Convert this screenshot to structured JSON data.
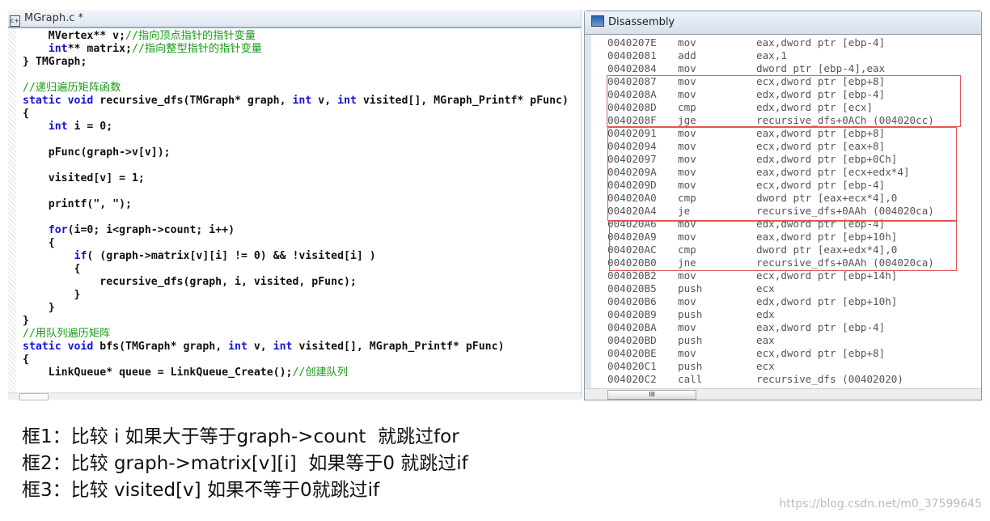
{
  "editor": {
    "title": "MGraph.c *",
    "lines": [
      [
        {
          "t": "    MVertex** v;"
        },
        {
          "t": "//指向顶点指针的指针变量",
          "c": "cm"
        }
      ],
      [
        {
          "t": "    "
        },
        {
          "t": "int",
          "c": "kw"
        },
        {
          "t": "** matrix;"
        },
        {
          "t": "//指向整型指针的指针变量",
          "c": "cm"
        }
      ],
      [
        {
          "t": "} TMGraph;"
        }
      ],
      [],
      [
        {
          "t": "//递归遍历矩阵函数",
          "c": "cm"
        }
      ],
      [
        {
          "t": "static void",
          "c": "kw"
        },
        {
          "t": " recursive_dfs(TMGraph* graph, "
        },
        {
          "t": "int",
          "c": "kw"
        },
        {
          "t": " v, "
        },
        {
          "t": "int",
          "c": "kw"
        },
        {
          "t": " visited[], MGraph_Printf* pFunc)"
        }
      ],
      [
        {
          "t": "{"
        }
      ],
      [
        {
          "t": "    "
        },
        {
          "t": "int",
          "c": "kw"
        },
        {
          "t": " i = 0;"
        }
      ],
      [],
      [
        {
          "t": "    pFunc(graph->v[v]);"
        }
      ],
      [],
      [
        {
          "t": "    visited[v] = 1;"
        }
      ],
      [],
      [
        {
          "t": "    printf(\", \");"
        }
      ],
      [],
      [
        {
          "t": "    "
        },
        {
          "t": "for",
          "c": "kw"
        },
        {
          "t": "(i=0; i<graph->count; i++)"
        }
      ],
      [
        {
          "t": "    {"
        }
      ],
      [
        {
          "t": "        "
        },
        {
          "t": "if",
          "c": "kw"
        },
        {
          "t": "( (graph->matrix[v][i] != 0) && !visited[i] )"
        }
      ],
      [
        {
          "t": "        {"
        }
      ],
      [
        {
          "t": "            recursive_dfs(graph, i, visited, pFunc);"
        }
      ],
      [
        {
          "t": "        }"
        }
      ],
      [
        {
          "t": "    }"
        }
      ],
      [
        {
          "t": "}"
        }
      ],
      [
        {
          "t": "//用队列遍历矩阵",
          "c": "cm"
        }
      ],
      [
        {
          "t": "static void",
          "c": "kw"
        },
        {
          "t": " bfs(TMGraph* graph, "
        },
        {
          "t": "int",
          "c": "kw"
        },
        {
          "t": " v, "
        },
        {
          "t": "int",
          "c": "kw"
        },
        {
          "t": " visited[], MGraph_Printf* pFunc)"
        }
      ],
      [
        {
          "t": "{"
        }
      ],
      [
        {
          "t": "    LinkQueue* queue = LinkQueue_Create();"
        },
        {
          "t": "//创建队列",
          "c": "cm"
        }
      ]
    ]
  },
  "disassembly": {
    "title": "Disassembly",
    "scroll_thumb": "III",
    "rows": [
      [
        "0040207E",
        "mov",
        "eax,dword ptr [ebp-4]"
      ],
      [
        "00402081",
        "add",
        "eax,1"
      ],
      [
        "00402084",
        "mov",
        "dword ptr [ebp-4],eax"
      ],
      [
        "00402087",
        "mov",
        "ecx,dword ptr [ebp+8]"
      ],
      [
        "0040208A",
        "mov",
        "edx,dword ptr [ebp-4]"
      ],
      [
        "0040208D",
        "cmp",
        "edx,dword ptr [ecx]"
      ],
      [
        "0040208F",
        "jge",
        "recursive_dfs+0ACh (004020cc)"
      ],
      [
        "00402091",
        "mov",
        "eax,dword ptr [ebp+8]"
      ],
      [
        "00402094",
        "mov",
        "ecx,dword ptr [eax+8]"
      ],
      [
        "00402097",
        "mov",
        "edx,dword ptr [ebp+0Ch]"
      ],
      [
        "0040209A",
        "mov",
        "eax,dword ptr [ecx+edx*4]"
      ],
      [
        "0040209D",
        "mov",
        "ecx,dword ptr [ebp-4]"
      ],
      [
        "004020A0",
        "cmp",
        "dword ptr [eax+ecx*4],0"
      ],
      [
        "004020A4",
        "je",
        "recursive_dfs+0AAh (004020ca)"
      ],
      [
        "004020A6",
        "mov",
        "edx,dword ptr [ebp-4]"
      ],
      [
        "004020A9",
        "mov",
        "eax,dword ptr [ebp+10h]"
      ],
      [
        "004020AC",
        "cmp",
        "dword ptr [eax+edx*4],0"
      ],
      [
        "004020B0",
        "jne",
        "recursive_dfs+0AAh (004020ca)"
      ],
      [
        "004020B2",
        "mov",
        "ecx,dword ptr [ebp+14h]"
      ],
      [
        "004020B5",
        "push",
        "ecx"
      ],
      [
        "004020B6",
        "mov",
        "edx,dword ptr [ebp+10h]"
      ],
      [
        "004020B9",
        "push",
        "edx"
      ],
      [
        "004020BA",
        "mov",
        "eax,dword ptr [ebp-4]"
      ],
      [
        "004020BD",
        "push",
        "eax"
      ],
      [
        "004020BE",
        "mov",
        "ecx,dword ptr [ebp+8]"
      ],
      [
        "004020C1",
        "push",
        "ecx"
      ],
      [
        "004020C2",
        "call",
        "recursive_dfs (00402020)"
      ]
    ],
    "highlight_color": "#e55555"
  },
  "notes": [
    "框1：比较 i 如果大于等于graph->count  就跳过for",
    "框2：比较 graph->matrix[v][i]  如果等于0 就跳过if",
    "框3：比较 visited[v] 如果不等于0就跳过if"
  ],
  "watermark": "https://blog.csdn.net/m0_37599645"
}
